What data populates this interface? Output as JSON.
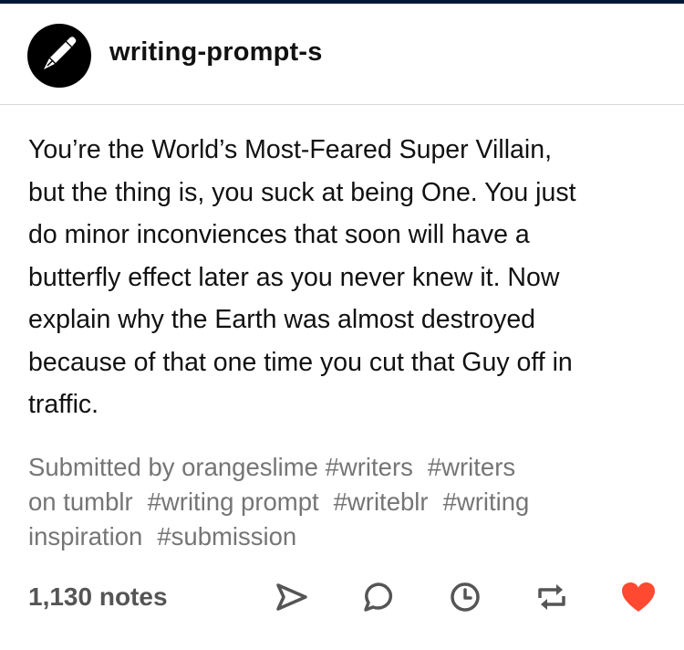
{
  "post": {
    "blog_name": "writing-prompt-s",
    "avatar_icon": "pen-icon",
    "body_lines": [
      "You’re the World’s Most-Feared Super Villain,",
      "but the thing is, you suck at being One. You just",
      "do minor inconviences that soon will have a",
      "butterfly effect later as you never knew it. Now",
      "explain why the Earth was almost destroyed",
      "because of that one time you cut that Guy off in",
      "traffic."
    ],
    "submitted_by": "Submitted by orangeslime",
    "tags": [
      "#writers",
      "#writers on tumblr",
      "#writing prompt",
      "#writeblr",
      "#writing inspiration",
      "#submission"
    ],
    "tag_lines": [
      [
        "Submitted by orangeslime",
        "#writers",
        "#writers"
      ],
      [
        "on tumblr",
        "#writing prompt",
        "#writeblr",
        "#writing"
      ],
      [
        "inspiration",
        "#submission"
      ]
    ],
    "notes": "1,130 notes"
  },
  "actions": {
    "share_icon": "share-icon",
    "reply_icon": "reply-icon",
    "queue_icon": "queue-clock-icon",
    "reblog_icon": "reblog-icon",
    "like_icon": "heart-icon"
  },
  "colors": {
    "top_bar": "#001935",
    "tag_text": "#757575",
    "icon_gray": "#555555",
    "liked_heart": "#ff4930"
  }
}
